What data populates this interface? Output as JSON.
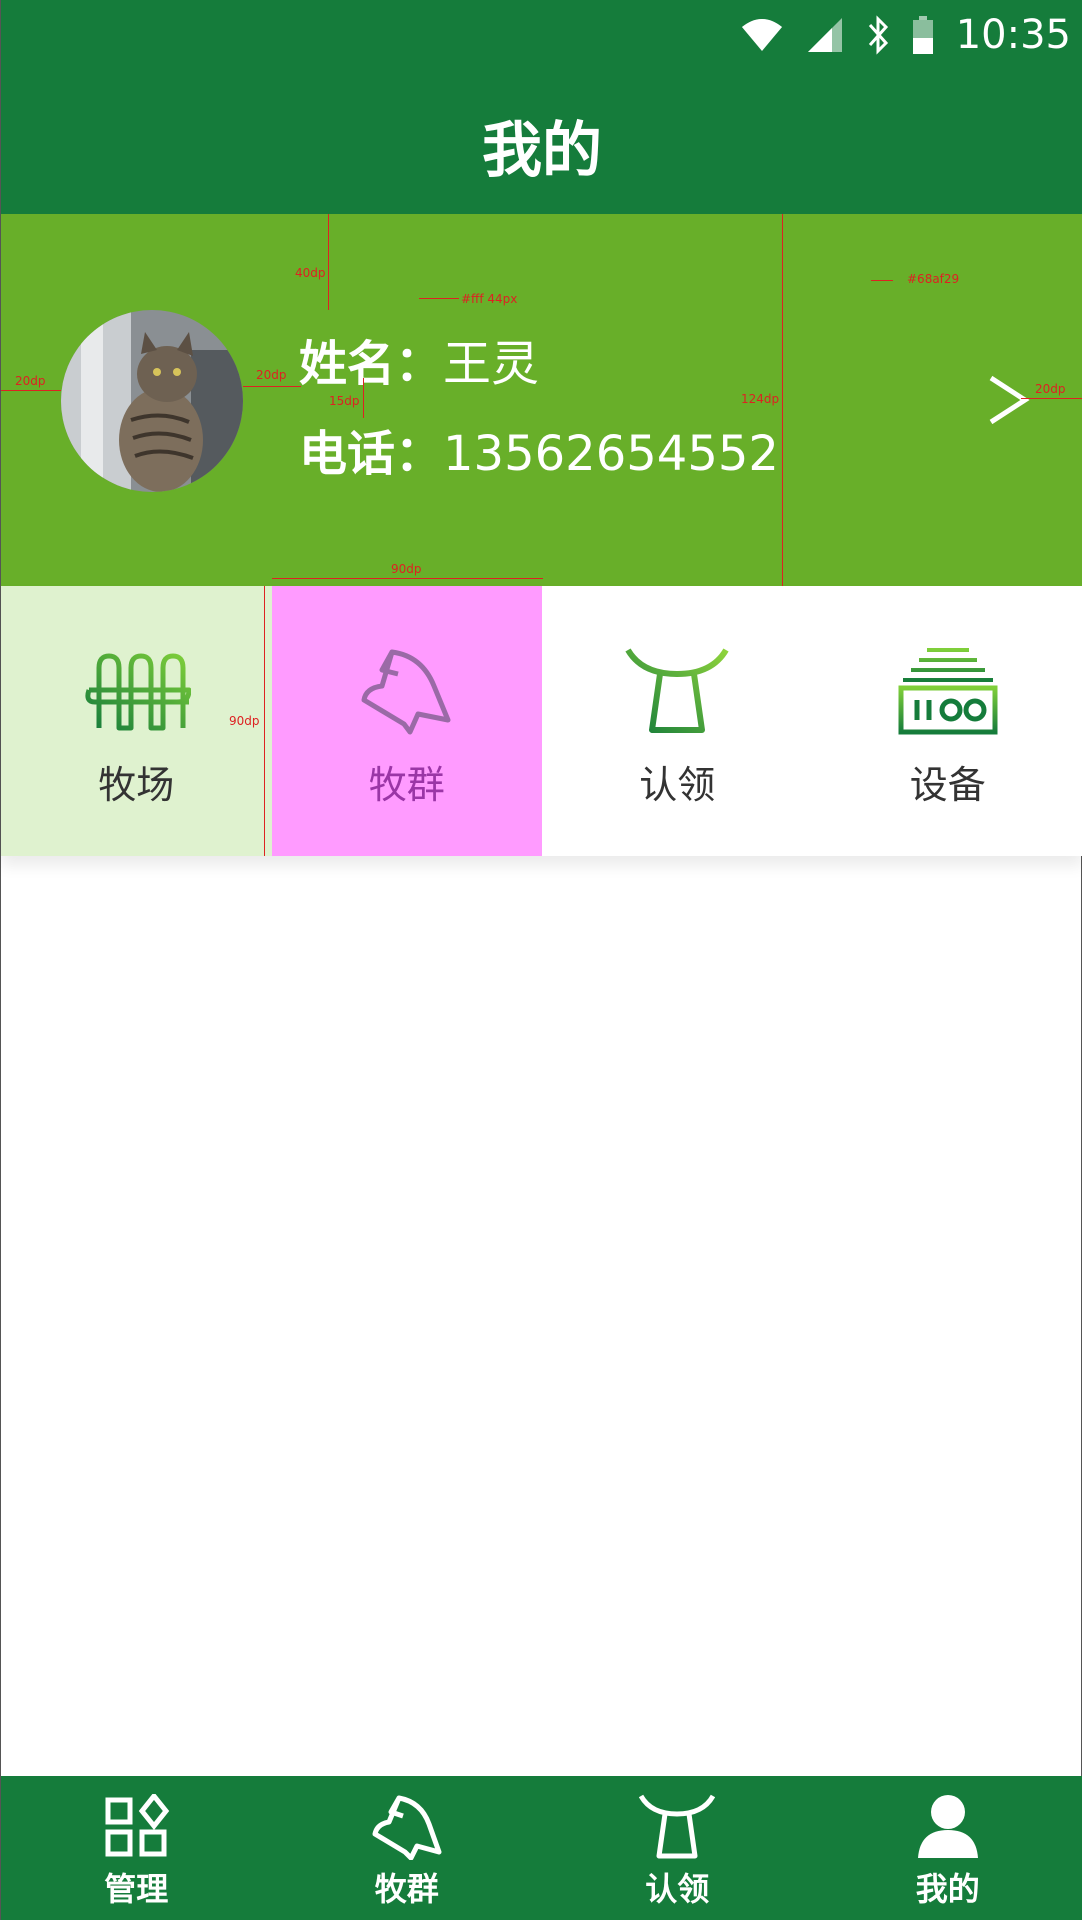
{
  "status_bar": {
    "time": "10:35",
    "icons": [
      "wifi-icon",
      "cellular-signal-icon",
      "bluetooth-icon",
      "battery-icon"
    ]
  },
  "header": {
    "title": "我的"
  },
  "profile": {
    "name_label": "姓名：",
    "name_value": "王灵",
    "phone_label": "电话：",
    "phone_value": "13562654552",
    "avatar": "cat-photo",
    "chevron": "chevron-right-icon"
  },
  "annotations": {
    "top_gap": "40dp",
    "text_style": "#fff 44px",
    "bg_color": "#68af29",
    "left_margin": "20dp",
    "avatar_gap": "20dp",
    "line_gap": "15dp",
    "card_height": "124dp",
    "right_margin": "20dp",
    "grid_width": "90dp",
    "grid_height": "90dp"
  },
  "grid": {
    "items": [
      {
        "label": "牧场",
        "icon": "fence-icon"
      },
      {
        "label": "牧群",
        "icon": "horse-head-icon"
      },
      {
        "label": "认领",
        "icon": "cow-tag-icon"
      },
      {
        "label": "设备",
        "icon": "device-icon"
      }
    ]
  },
  "bottom_nav": {
    "items": [
      {
        "label": "管理",
        "icon": "grid-diamond-icon"
      },
      {
        "label": "牧群",
        "icon": "horse-head-icon"
      },
      {
        "label": "认领",
        "icon": "cow-tag-icon"
      },
      {
        "label": "我的",
        "icon": "person-icon"
      }
    ]
  },
  "colors": {
    "primary": "#157c3b",
    "card": "#68af29",
    "pasture_bg": "#dff2cf",
    "herd_bg": "#ff9bff",
    "annotation": "#dd2222"
  }
}
